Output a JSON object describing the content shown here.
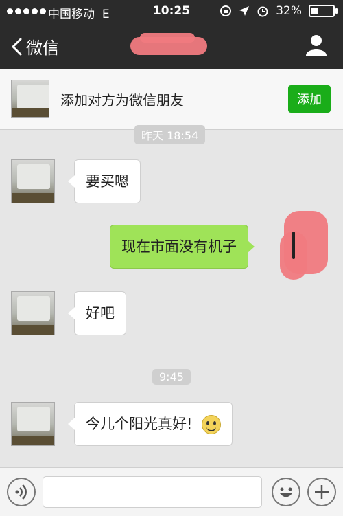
{
  "status_bar": {
    "carrier": "中国移动",
    "network": "E",
    "time": "10:25",
    "battery": "32%",
    "battery_level": 0.32
  },
  "nav": {
    "back_label": "微信"
  },
  "banner": {
    "text": "添加对方为微信朋友",
    "button_label": "添加"
  },
  "messages": [
    {
      "type": "time",
      "text": "昨天 18:54"
    },
    {
      "type": "incoming",
      "text": "要买嗯"
    },
    {
      "type": "outgoing",
      "text": "现在市面没有机子"
    },
    {
      "type": "incoming",
      "text": "好吧"
    },
    {
      "type": "time",
      "text": "9:45"
    },
    {
      "type": "incoming",
      "text": "今儿个阳光真好!",
      "emoji": "smile-emoji"
    }
  ],
  "colors": {
    "nav_bg": "#2b2b2b",
    "accent_green": "#1aad19",
    "outgoing_bubble": "#9fe358",
    "chat_bg": "#e6e6e6",
    "redaction": "#f07a80"
  }
}
